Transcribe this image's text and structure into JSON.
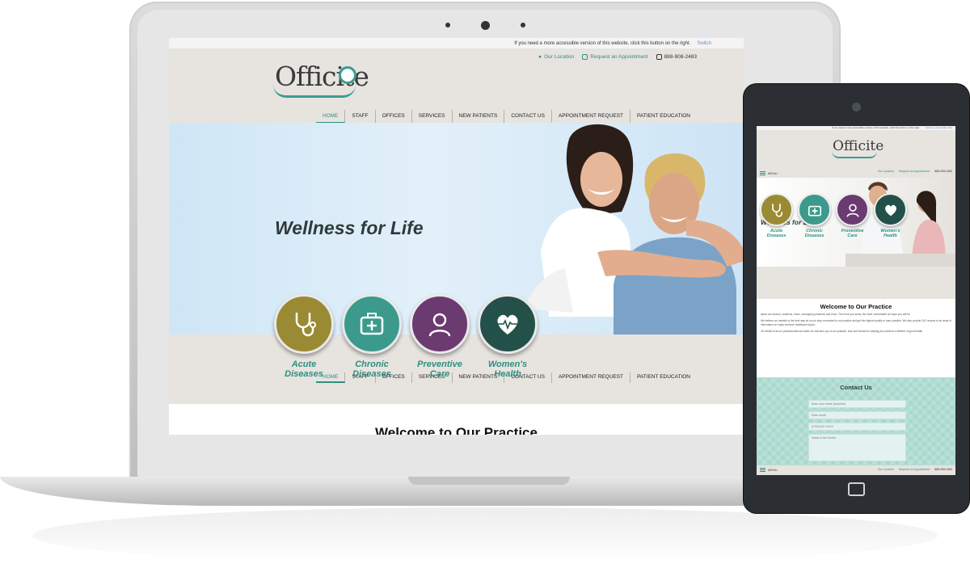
{
  "desktop": {
    "access_text": "If you need a more accessible version of this website, click this button on the right.",
    "access_switch": "Switch",
    "logo": "Officite",
    "top_links": {
      "location": "Our Location",
      "appointment": "Request an Appointment",
      "phone": "888-908-2483"
    },
    "nav": [
      "HOME",
      "STAFF",
      "OFFICES",
      "SERVICES",
      "NEW PATIENTS",
      "CONTACT US",
      "APPOINTMENT REQUEST",
      "PATIENT EDUCATION"
    ],
    "hero_title": "Wellness for Life",
    "circles": [
      {
        "line1": "Acute",
        "line2": "Diseases",
        "color": "#9a8a33",
        "icon": "stethoscope-icon"
      },
      {
        "line1": "Chronic",
        "line2": "Diseases",
        "color": "#3b9a8b",
        "icon": "medical-kit-icon"
      },
      {
        "line1": "Preventive",
        "line2": "Care",
        "color": "#6a3a70",
        "icon": "doctor-icon"
      },
      {
        "line1": "Women's",
        "line2": "Health",
        "color": "#24504a",
        "icon": "heart-pulse-icon"
      }
    ],
    "welcome": "Welcome to Our Practice"
  },
  "tablet": {
    "access_text": "If you need a more accessible version of this website, click this button on the right.",
    "access_switch": "Switch to Accessible Site",
    "logo": "Officite",
    "menu": "MENU",
    "top_links": {
      "location": "Our Location",
      "appointment": "Request an Appointment",
      "phone": "888-908-2483"
    },
    "hero_title": "Wellness for Life",
    "circles": [
      {
        "line1": "Acute",
        "line2": "Diseases"
      },
      {
        "line1": "Chronic",
        "line2": "Diseases"
      },
      {
        "line1": "Preventive",
        "line2": "Care"
      },
      {
        "line1": "Women's",
        "line2": "Health"
      }
    ],
    "welcome": "Welcome to Our Practice",
    "body": [
      "about our doctors, locations, hours, emergency practices and more. The more you know, the more comfortable we hope you will be.",
      "We believe our website is the best way for you to stay connected to our practice and get the highest quality of care possible. We also provide 24/7 access to an array of information on many common healthcare topics.",
      "On behalf of all our professionals and staff, we welcome you to our practice, and look forward to helping you preserve a lifetime of good health."
    ],
    "contact_title": "Contact Us",
    "fields": {
      "name": "Enter your name (required)",
      "email": "Enter email",
      "phone": "(XXX)XXX-XXXX",
      "notes": "Notes to the Doctor"
    }
  },
  "colors": {
    "teal": "#2e8f80",
    "header_bg": "#e7e3df",
    "contact_bg": "#a8d8cd"
  }
}
